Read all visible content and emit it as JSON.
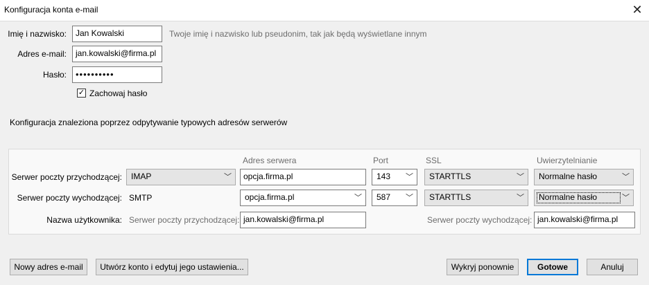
{
  "window": {
    "title": "Konfiguracja konta e-mail",
    "close_glyph": "✕"
  },
  "form": {
    "name_label": "Imię i nazwisko:",
    "name_value": "Jan Kowalski",
    "name_hint": "Twoje imię i nazwisko lub pseudonim, tak jak będą wyświetlane innym",
    "email_label": "Adres e-mail:",
    "email_value": "jan.kowalski@firma.pl",
    "password_label": "Hasło:",
    "password_value": "••••••••••",
    "remember_label": "Zachowaj hasło",
    "remember_checked": true,
    "remember_glyph": "✓"
  },
  "status_text": "Konfiguracja znaleziona poprzez odpytywanie typowych adresów serwerów",
  "servers": {
    "headers": {
      "address": "Adres serwera",
      "port": "Port",
      "ssl": "SSL",
      "auth": "Uwierzytelnianie"
    },
    "incoming": {
      "label": "Serwer poczty przychodzącej:",
      "protocol": "IMAP",
      "address": "opcja.firma.pl",
      "port": "143",
      "ssl": "STARTTLS",
      "auth": "Normalne hasło"
    },
    "outgoing": {
      "label": "Serwer poczty wychodzącej:",
      "protocol": "SMTP",
      "address": "opcja.firma.pl",
      "port": "587",
      "ssl": "STARTTLS",
      "auth": "Normalne hasło"
    },
    "username": {
      "label": "Nazwa użytkownika:",
      "incoming_label": "Serwer poczty przychodzącej:",
      "incoming_value": "jan.kowalski@firma.pl",
      "outgoing_label": "Serwer poczty wychodzącej:",
      "outgoing_value": "jan.kowalski@firma.pl"
    }
  },
  "icons": {
    "dropdown": "chevron-down-icon",
    "dropdown_glyph": "﹀"
  },
  "buttons": {
    "new_email": "Nowy adres e-mail",
    "advanced": "Utwórz konto i edytuj jego ustawienia...",
    "retest": "Wykryj ponownie",
    "done": "Gotowe",
    "cancel": "Anuluj"
  },
  "colors": {
    "focus_border": "#0078d7",
    "hint": "#6d6d6d"
  }
}
